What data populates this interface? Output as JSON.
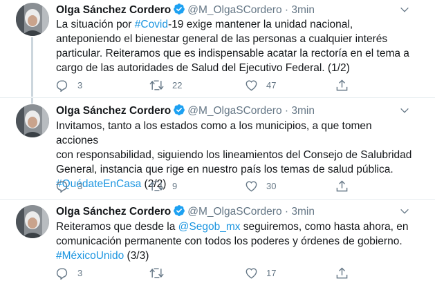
{
  "colors": {
    "link": "#1b95e0",
    "muted": "#657786",
    "verified": "#1da1f2",
    "divider": "#e6ecf0"
  },
  "icons": [
    "verified-badge-icon",
    "chevron-down-icon",
    "reply-icon",
    "retweet-icon",
    "like-icon",
    "share-icon"
  ],
  "tweets": [
    {
      "name": "Olga Sánchez Cordero",
      "handle": "@M_OlgaSCordero",
      "dot": "·",
      "time": "3min",
      "lines": [
        {
          "pre": "La situación por ",
          "link": "#Covid",
          "post": "-19 exige mantener la unidad nacional,"
        },
        {
          "pre": "anteponiendo el bienestar general de las personas a cualquier interés"
        },
        {
          "pre": "particular. Reiteramos que es indispensable acatar la rectoría en el tema a"
        },
        {
          "pre": "cargo de las autoridades de Salud del Ejecutivo Federal. (1/2)"
        }
      ],
      "replies": "3",
      "retweets": "22",
      "likes": "47"
    },
    {
      "name": "Olga Sánchez Cordero",
      "handle": "@M_OlgaSCordero",
      "dot": "·",
      "time": "3min",
      "lines": [
        {
          "pre": "Invitamos, tanto a los estados como a los municipios, a que tomen acciones"
        },
        {
          "pre": "con responsabilidad, siguiendo los lineamientos del Consejo de Salubridad"
        },
        {
          "pre": "General, instancia que rige en nuestro país los temas de salud pública."
        },
        {
          "pre": "",
          "link": "#QuédateEnCasa",
          "post": " (2/2)"
        }
      ],
      "replies": "3",
      "retweets": "9",
      "likes": "30"
    },
    {
      "name": "Olga Sánchez Cordero",
      "handle": "@M_OlgaSCordero",
      "dot": "·",
      "time": "3min",
      "lines": [
        {
          "pre": "Reiteramos que desde la ",
          "link": "@Segob_mx",
          "post": " seguiremos, como hasta ahora, en"
        },
        {
          "pre": "comunicación permanente con todos los poderes y órdenes de gobierno."
        },
        {
          "pre": "",
          "link": "#MéxicoUnido",
          "post": " (3/3)"
        }
      ],
      "replies": "3",
      "retweets": "",
      "likes": "17"
    }
  ]
}
